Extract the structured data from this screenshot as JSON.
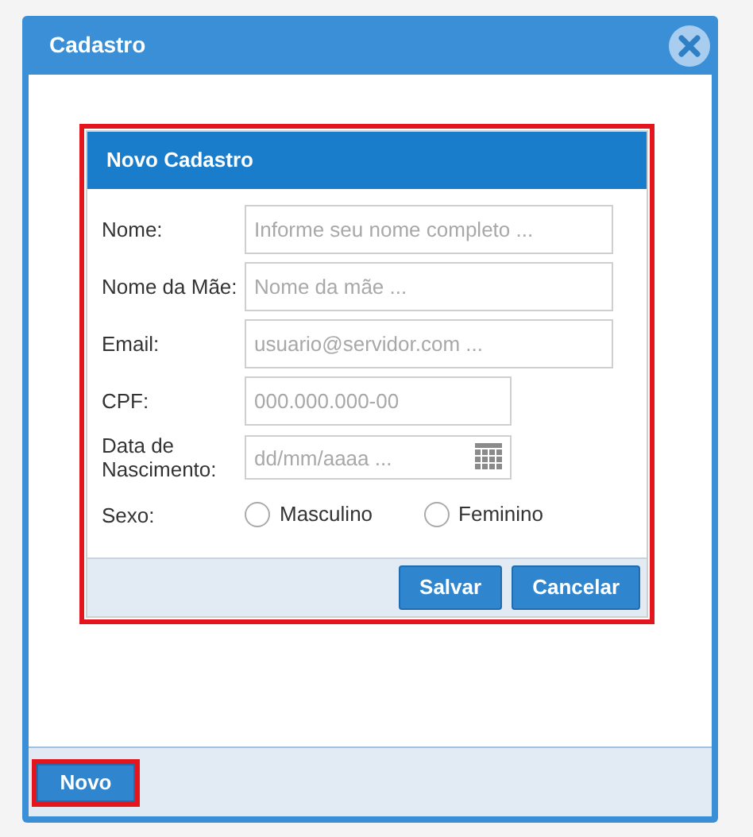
{
  "window": {
    "title": "Cadastro"
  },
  "form": {
    "title": "Novo Cadastro",
    "highlighted": true,
    "fields": [
      {
        "kind": "text",
        "label": "Nome:",
        "placeholder": "Informe seu nome completo ..."
      },
      {
        "kind": "text",
        "label": "Nome da Mãe:",
        "placeholder": "Nome da mãe ..."
      },
      {
        "kind": "text",
        "label": "Email:",
        "placeholder": "usuario@servidor.com ..."
      },
      {
        "kind": "short",
        "label": "CPF:",
        "placeholder": "000.000.000-00"
      },
      {
        "kind": "date",
        "label": "Data de Nascimento:",
        "placeholder": "dd/mm/aaaa ..."
      },
      {
        "kind": "radio",
        "label": "Sexo:",
        "options": [
          {
            "label": "Masculino",
            "selected": false
          },
          {
            "label": "Feminino",
            "selected": false
          }
        ]
      }
    ],
    "buttons": [
      "Salvar",
      "Cancelar"
    ]
  },
  "footer": {
    "button": "Novo",
    "highlighted": true
  }
}
